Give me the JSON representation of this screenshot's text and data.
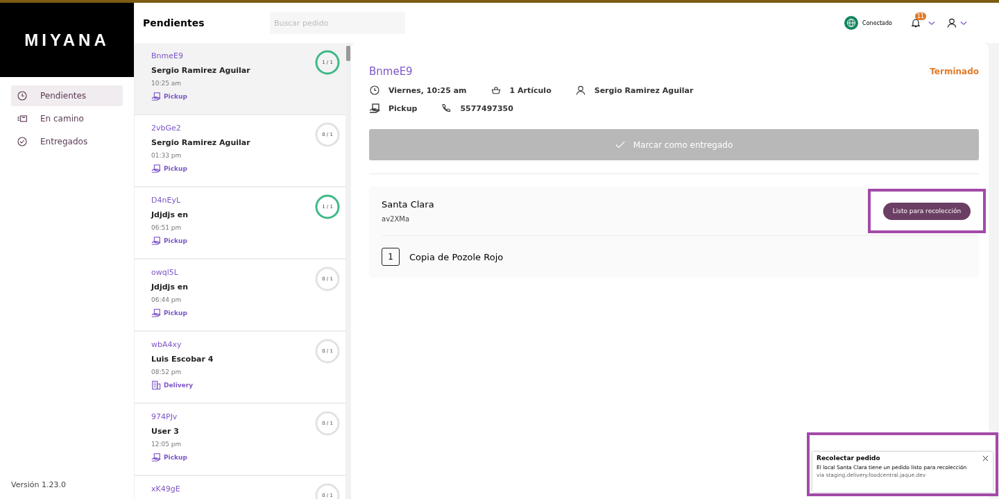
{
  "brand": "MIYANA",
  "nav": [
    {
      "label": "Pendientes",
      "selected": true
    },
    {
      "label": "En camino",
      "selected": false
    },
    {
      "label": "Entregados",
      "selected": false
    }
  ],
  "version": "Versión 1.23.0",
  "header": {
    "title": "Pendientes",
    "search": {
      "placeholder": "Buscar pedido"
    },
    "status": "Conectado",
    "notifications": "11"
  },
  "orders": [
    {
      "code": "BnmeE9",
      "customer": "Sergio Ramirez Aguilar",
      "time": "10:25 am",
      "kind": "pickup",
      "type": "Pickup",
      "progress": "1 / 1",
      "complete": true,
      "selected": true
    },
    {
      "code": "2vbGe2",
      "customer": "Sergio Ramirez Aguilar",
      "time": "01:33 pm",
      "kind": "pickup",
      "type": "Pickup",
      "progress": "0 / 1",
      "complete": false,
      "selected": false
    },
    {
      "code": "D4nEyL",
      "customer": "Jdjdjs en",
      "time": "06:51 pm",
      "kind": "pickup",
      "type": "Pickup",
      "progress": "1 / 1",
      "complete": true,
      "selected": false
    },
    {
      "code": "owql5L",
      "customer": "Jdjdjs en",
      "time": "06:44 pm",
      "kind": "pickup",
      "type": "Pickup",
      "progress": "0 / 1",
      "complete": false,
      "selected": false
    },
    {
      "code": "wbA4xy",
      "customer": "Luis Escobar 4",
      "time": "08:52 pm",
      "kind": "delivery",
      "type": "Delivery",
      "progress": "0 / 1",
      "complete": false,
      "selected": false
    },
    {
      "code": "974PJv",
      "customer": "User 3",
      "time": "12:05 pm",
      "kind": "pickup",
      "type": "Pickup",
      "progress": "0 / 1",
      "complete": false,
      "selected": false
    },
    {
      "code": "xK49gE",
      "progress": "0 / 1",
      "complete": false,
      "selected": false
    }
  ],
  "detail": {
    "code": "BnmeE9",
    "status": "Terminado",
    "when": "Viernes, 10:25 am",
    "items": "1 Artículo",
    "customer": "Sergio Ramirez Aguilar",
    "type": "Pickup",
    "phone": "5577497350",
    "action": "Marcar como entregado",
    "action_disabled": true,
    "store": {
      "name": "Santa Clara",
      "code": "av2XMa",
      "button": "Listo para recolección",
      "products": [
        {
          "qty": "1",
          "name": "Copia de Pozole Rojo"
        }
      ]
    }
  },
  "toast": {
    "title": "Recolectar pedido",
    "message": "El local Santa Clara tiene un pedido listo para recolección",
    "source": "via staging.delivery.foodcentral.jaque.dev"
  }
}
